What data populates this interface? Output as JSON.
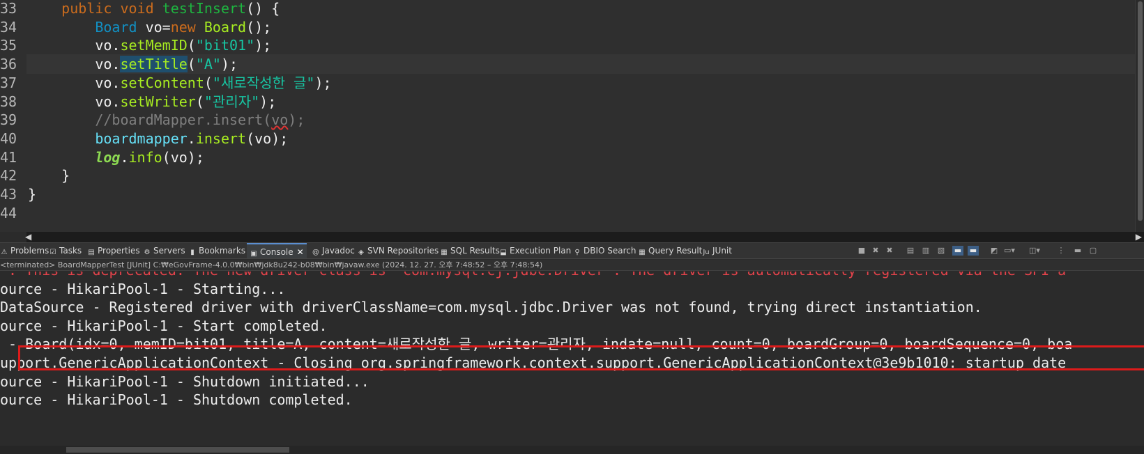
{
  "editor": {
    "lines": [
      {
        "n": "33",
        "tokens": [
          [
            "    ",
            "var"
          ],
          [
            "public",
            "kw"
          ],
          [
            " ",
            "var"
          ],
          [
            "void",
            "kw"
          ],
          [
            " ",
            "var"
          ],
          [
            "testInsert",
            "fn"
          ],
          [
            "() {",
            "var"
          ]
        ]
      },
      {
        "n": "34",
        "tokens": [
          [
            "        ",
            "var"
          ],
          [
            "Board",
            "ty"
          ],
          [
            " vo=",
            "var"
          ],
          [
            "new",
            "kw"
          ],
          [
            " ",
            "var"
          ],
          [
            "Board",
            "met"
          ],
          [
            "();",
            "var"
          ]
        ]
      },
      {
        "n": "35",
        "tokens": [
          [
            "        vo.",
            "var"
          ],
          [
            "setMemID",
            "met"
          ],
          [
            "(",
            "var"
          ],
          [
            "\"bit01\"",
            "str"
          ],
          [
            ");",
            "var"
          ]
        ]
      },
      {
        "n": "36",
        "tokens": [
          [
            "        vo.",
            "var"
          ],
          [
            "setTitle",
            "met hl"
          ],
          [
            "(",
            "var"
          ],
          [
            "\"A\"",
            "str"
          ],
          [
            ");",
            "var"
          ]
        ],
        "current": true
      },
      {
        "n": "37",
        "tokens": [
          [
            "        vo.",
            "var"
          ],
          [
            "setContent",
            "met"
          ],
          [
            "(",
            "var"
          ],
          [
            "\"새로작성한 글\"",
            "str"
          ],
          [
            ");",
            "var"
          ]
        ]
      },
      {
        "n": "38",
        "tokens": [
          [
            "        vo.",
            "var"
          ],
          [
            "setWriter",
            "met"
          ],
          [
            "(",
            "var"
          ],
          [
            "\"관리자\"",
            "str"
          ],
          [
            ");",
            "var"
          ]
        ]
      },
      {
        "n": "39",
        "tokens": [
          [
            "        ",
            "var"
          ],
          [
            "//boardMapper.insert(",
            "cmt"
          ],
          [
            "vo",
            "cmt squig"
          ],
          [
            ");",
            "cmt"
          ]
        ]
      },
      {
        "n": "40",
        "tokens": [
          [
            "        ",
            "var"
          ],
          [
            "boardmapper",
            "fld"
          ],
          [
            ".",
            "var"
          ],
          [
            "insert",
            "met"
          ],
          [
            "(vo);",
            "var"
          ]
        ]
      },
      {
        "n": "41",
        "tokens": [
          [
            "        ",
            "var"
          ],
          [
            "log",
            "log"
          ],
          [
            ".",
            "var"
          ],
          [
            "info",
            "met"
          ],
          [
            "(vo);",
            "var"
          ]
        ]
      },
      {
        "n": "42",
        "tokens": [
          [
            "    }",
            "var"
          ]
        ]
      },
      {
        "n": "43",
        "tokens": [
          [
            "}",
            "var"
          ]
        ]
      },
      {
        "n": "44",
        "tokens": []
      }
    ]
  },
  "tabs": [
    {
      "label": "Problems",
      "icon": "problems-icon",
      "glyph": "⚠"
    },
    {
      "label": "Tasks",
      "icon": "tasks-icon",
      "glyph": "☑"
    },
    {
      "label": "Properties",
      "icon": "properties-icon",
      "glyph": "▤"
    },
    {
      "label": "Servers",
      "icon": "servers-icon",
      "glyph": "⚙"
    },
    {
      "label": "Bookmarks",
      "icon": "bookmarks-icon",
      "glyph": "▮"
    },
    {
      "label": "Console",
      "icon": "console-icon",
      "glyph": "▣",
      "active": true
    },
    {
      "label": "Javadoc",
      "icon": "javadoc-icon",
      "glyph": "@"
    },
    {
      "label": "SVN Repositories",
      "icon": "svn-icon",
      "glyph": "◈"
    },
    {
      "label": "SQL Results",
      "icon": "sql-results-icon",
      "glyph": "▦"
    },
    {
      "label": "Execution Plan",
      "icon": "execution-plan-icon",
      "glyph": "⬓"
    },
    {
      "label": "DBIO Search",
      "icon": "dbio-search-icon",
      "glyph": "⚲"
    },
    {
      "label": "Query Result",
      "icon": "query-result-icon",
      "glyph": "▦"
    },
    {
      "label": "JUnit",
      "icon": "junit-icon",
      "glyph": "Ju"
    }
  ],
  "console": {
    "status": "<terminated> BoardMapperTest [JUnit] C:₩eGovFrame-4.0.0₩bin₩jdk8u242-b08₩bin₩javaw.exe  (2024. 12. 27. 오후 7:48:52 – 오후 7:48:54)",
    "lines": [
      {
        "text": "'. This is deprecated. The new driver class is `com.mysql.cj.jdbc.Driver'. The driver is automatically registered via the SPI a",
        "err": true
      },
      {
        "text": "ource - HikariPool-1 - Starting..."
      },
      {
        "text": "DataSource - Registered driver with driverClassName=com.mysql.jdbc.Driver was not found, trying direct instantiation."
      },
      {
        "text": "ource - HikariPool-1 - Start completed."
      },
      {
        "text": " - Board(idx=0, memID=bit01, title=A, content=새로작성한 글, writer=관리자, indate=null, count=0, boardGroup=0, boardSequence=0, boa"
      },
      {
        "text": "upport.GenericApplicationContext - Closing org.springframework.context.support.GenericApplicationContext@3e9b1010: startup date"
      },
      {
        "text": "ource - HikariPool-1 - Shutdown initiated..."
      },
      {
        "text": "ource - HikariPool-1 - Shutdown completed."
      }
    ]
  },
  "colors": {
    "highlight_box": "#dd1b1b",
    "error_text": "#e4434b"
  }
}
